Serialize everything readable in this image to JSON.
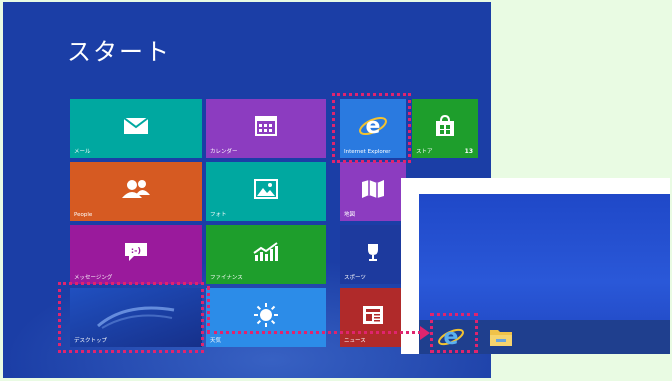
{
  "start_screen": {
    "title": "スタート",
    "tiles": {
      "mail": "メール",
      "calendar": "カレンダー",
      "ie": "Internet Explorer",
      "store": "ストア",
      "store_badge": "13",
      "people": "People",
      "photos": "フォト",
      "maps": "地図",
      "messaging": "メッセージング",
      "finance": "ファイナンス",
      "sports": "スポーツ",
      "desktop": "デスクトップ",
      "weather": "天気",
      "news": "ニュース"
    }
  },
  "highlight_color": "#e0246e",
  "desktop_view": {
    "taskbar_icons": [
      "internet-explorer-icon",
      "file-explorer-icon"
    ]
  }
}
